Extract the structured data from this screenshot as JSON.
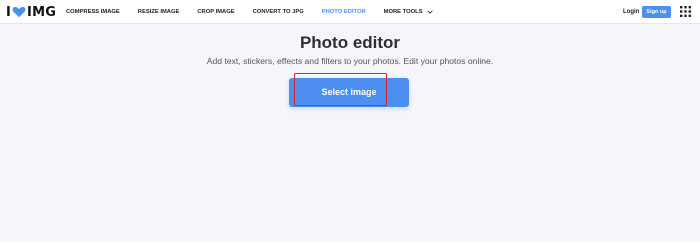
{
  "header": {
    "logo": {
      "left": "I",
      "right": "IMG",
      "heart_color": "#4d8ff0"
    },
    "nav": [
      {
        "label": "COMPRESS IMAGE"
      },
      {
        "label": "RESIZE IMAGE"
      },
      {
        "label": "CROP IMAGE"
      },
      {
        "label": "CONVERT TO JPG"
      },
      {
        "label": "PHOTO EDITOR",
        "active": true
      },
      {
        "label": "MORE TOOLS",
        "icon": "chevron-down-icon"
      }
    ],
    "login_label": "Login",
    "signup_label": "Sign up",
    "apps_icon": "grid-menu-icon"
  },
  "main": {
    "title": "Photo editor",
    "subtitle": "Add text, stickers, effects and filters to your photos. Edit your photos online.",
    "select_button_label": "Select image"
  },
  "colors": {
    "accent": "#4d8ff0",
    "background": "#f5f5fa",
    "highlight": "#e02424"
  }
}
